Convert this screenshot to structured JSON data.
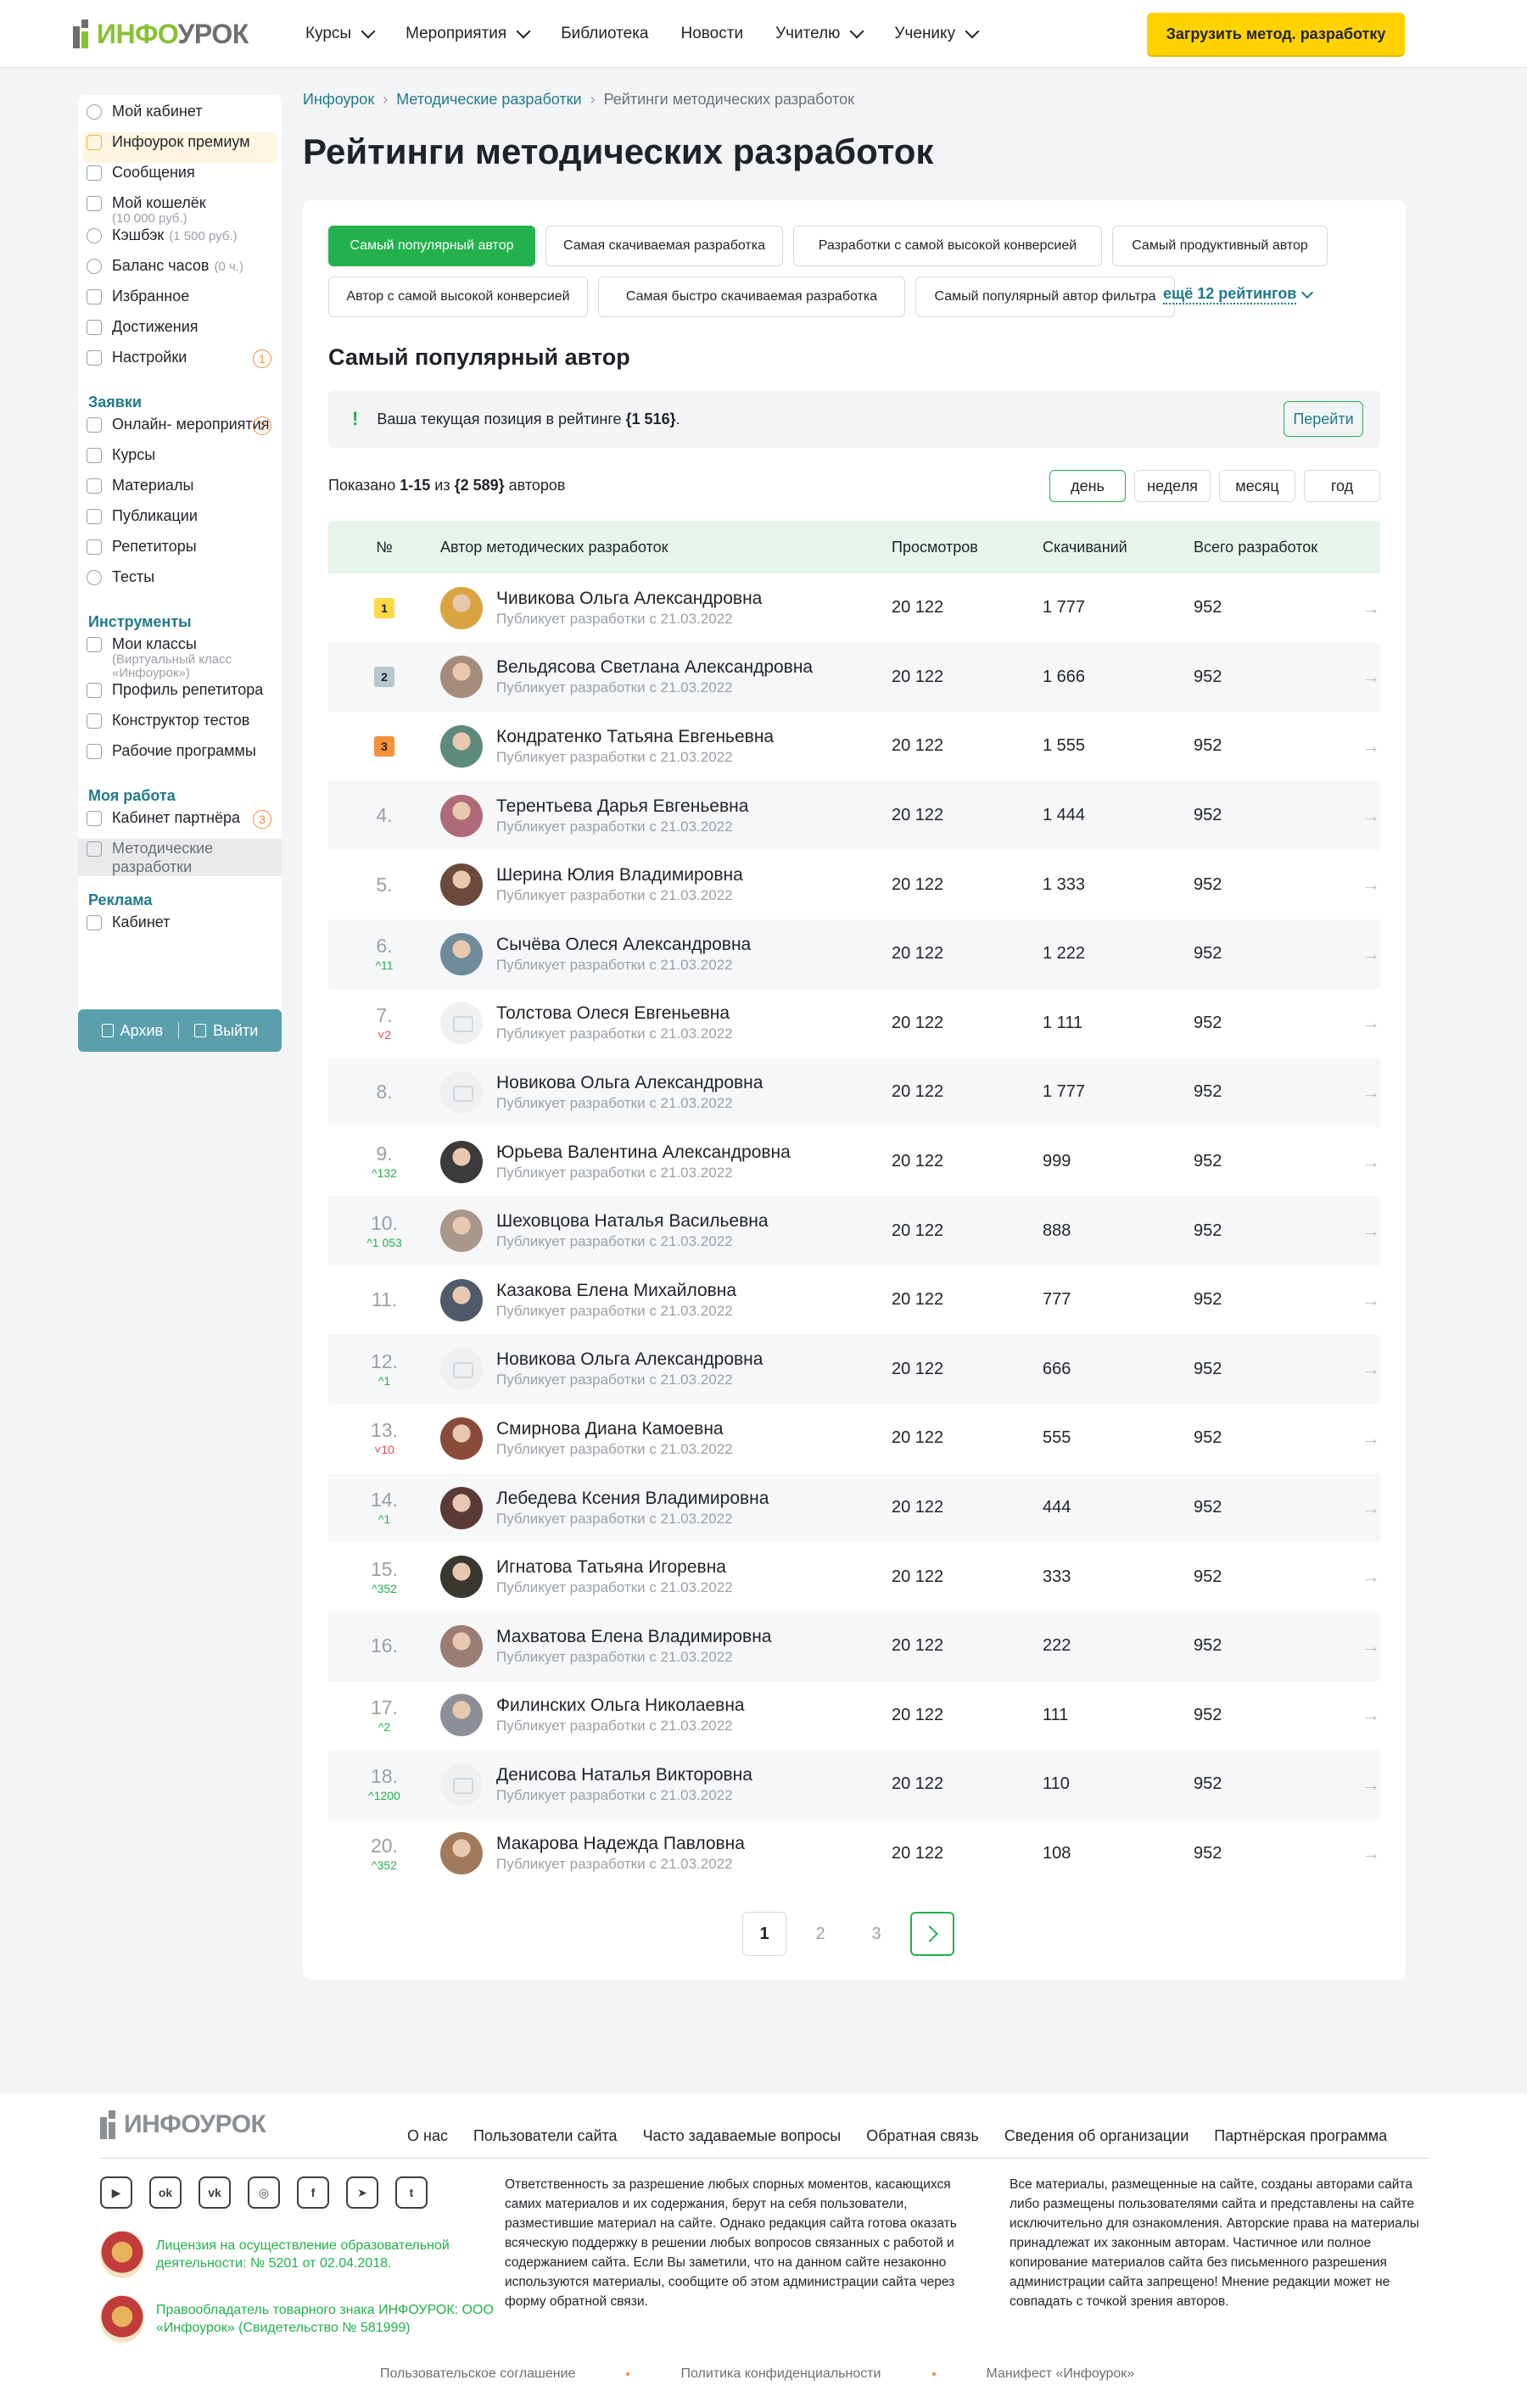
{
  "header": {
    "logo_text_a": "ИНФО",
    "logo_text_b": "УРОК",
    "nav": [
      {
        "label": "Курсы",
        "dropdown": true
      },
      {
        "label": "Мероприятия",
        "dropdown": true
      },
      {
        "label": "Библиотека",
        "dropdown": false
      },
      {
        "label": "Новости",
        "dropdown": false
      },
      {
        "label": "Учителю",
        "dropdown": true
      },
      {
        "label": "Ученику",
        "dropdown": true
      }
    ],
    "upload_label": "Загрузить метод. разработку"
  },
  "sidebar": {
    "items_top": [
      {
        "label": "Мой кабинет",
        "icon": "user-icon"
      },
      {
        "label": "Инфоурок премиум",
        "icon": "crown-icon"
      },
      {
        "label": "Сообщения",
        "icon": "mail-icon"
      },
      {
        "label": "Мой кошелёк",
        "sub2": "(10 000 руб.)",
        "icon": "wallet-icon"
      },
      {
        "label": "Кэшбэк",
        "sub": "(1 500 руб.)",
        "icon": "cashback-icon"
      },
      {
        "label": "Баланс часов",
        "sub": "(0 ч.)",
        "icon": "clock-icon"
      },
      {
        "label": "Избранное",
        "icon": "bookmark-icon"
      },
      {
        "label": "Достижения",
        "icon": "trophy-icon"
      },
      {
        "label": "Настройки",
        "icon": "gear-icon",
        "badge": "1"
      }
    ],
    "section_requests": "Заявки",
    "items_requests": [
      {
        "label": "Онлайн-\nмероприятия",
        "icon": "video-icon",
        "badge": "2"
      },
      {
        "label": "Курсы",
        "icon": "book-icon"
      },
      {
        "label": "Материалы",
        "icon": "star-icon"
      },
      {
        "label": "Публикации",
        "icon": "doc-icon"
      },
      {
        "label": "Репетиторы",
        "icon": "megaphone-icon"
      },
      {
        "label": "Тесты",
        "icon": "check-icon"
      }
    ],
    "section_tools": "Инструменты",
    "items_tools": [
      {
        "label": "Мои классы",
        "sub2": "(Виртуальный класс «Инфоурок»)",
        "icon": "group-icon"
      },
      {
        "label": "Профиль репетитора",
        "icon": "profile-icon"
      },
      {
        "label": "Конструктор тестов",
        "icon": "constructor-icon"
      },
      {
        "label": "Рабочие программы",
        "icon": "calendar-icon"
      }
    ],
    "section_work": "Моя работа",
    "items_work": [
      {
        "label": "Кабинет партнёра",
        "icon": "partner-icon",
        "badge": "3"
      },
      {
        "label": "Методические разработки",
        "icon": "doc-icon",
        "active": true
      }
    ],
    "section_ads": "Реклама",
    "items_ads": [
      {
        "label": "Кабинет",
        "icon": "grid-icon"
      }
    ],
    "archive_label": "Архив",
    "logout_label": "Выйти"
  },
  "breadcrumb": [
    "Инфоурок",
    "Методические разработки",
    "Рейтинги методических разработок"
  ],
  "page_title": "Рейтинги методических разработок",
  "tabs": [
    {
      "label": "Самый популярный автор",
      "active": true
    },
    {
      "label": "Самая скачиваемая разработка"
    },
    {
      "label": "Разработки с самой высокой конверсией"
    },
    {
      "label": "Самый продуктивный автор"
    },
    {
      "label": "Автор с самой высокой конверсией"
    },
    {
      "label": "Самая быстро скачиваемая разработка"
    },
    {
      "label": "Самый популярный автор фильтра"
    }
  ],
  "more_tabs_label": "ещё 12 рейтингов",
  "section_title": "Самый популярный автор",
  "notice": {
    "text_before": "Ваша текущая позиция в рейтинге ",
    "position": "{1 516}",
    "text_after": ".",
    "go_label": "Перейти"
  },
  "shown": {
    "prefix": "Показано ",
    "range": "1-15",
    "middle": " из ",
    "total": "{2 589}",
    "suffix": " авторов"
  },
  "periods": [
    {
      "label": "день",
      "active": true
    },
    {
      "label": "неделя"
    },
    {
      "label": "месяц"
    },
    {
      "label": "год"
    }
  ],
  "table": {
    "headers": [
      "№",
      "Автор методических разработок",
      "Просмотров",
      "Скачиваний",
      "Всего разработок"
    ],
    "rows": [
      {
        "rank": "1",
        "medal": "gold",
        "delta": "",
        "dir": "",
        "name": "Чивикова Ольга Александровна",
        "sub": "Публикует разработки с 21.03.2022",
        "views": "20 122",
        "downloads": "1 777",
        "total": "952",
        "avatar": "#d9a441"
      },
      {
        "rank": "2",
        "medal": "silver",
        "delta": "",
        "dir": "",
        "name": "Вельдясова Светлана Александровна",
        "sub": "Публикует разработки с 21.03.2022",
        "views": "20 122",
        "downloads": "1 666",
        "total": "952",
        "avatar": "#a58c7a"
      },
      {
        "rank": "3",
        "medal": "bronze",
        "delta": "",
        "dir": "",
        "name": "Кондратенко Татьяна Евгеньевна",
        "sub": "Публикует разработки с 21.03.2022",
        "views": "20 122",
        "downloads": "1 555",
        "total": "952",
        "avatar": "#5c8a7d"
      },
      {
        "rank": "4.",
        "medal": "",
        "delta": "",
        "dir": "",
        "name": "Терентьева Дарья Евгеньевна",
        "sub": "Публикует разработки с 21.03.2022",
        "views": "20 122",
        "downloads": "1 444",
        "total": "952",
        "avatar": "#b06b7a"
      },
      {
        "rank": "5.",
        "medal": "",
        "delta": "",
        "dir": "",
        "name": "Шерина Юлия Владимировна",
        "sub": "Публикует разработки с 21.03.2022",
        "views": "20 122",
        "downloads": "1 333",
        "total": "952",
        "avatar": "#6b4a3c"
      },
      {
        "rank": "6.",
        "medal": "",
        "delta": "11",
        "dir": "up",
        "name": "Сычёва Олеся Александровна",
        "sub": "Публикует разработки с 21.03.2022",
        "views": "20 122",
        "downloads": "1 222",
        "total": "952",
        "avatar": "#6f8a9a"
      },
      {
        "rank": "7.",
        "medal": "",
        "delta": "2",
        "dir": "down",
        "name": "Толстова Олеся Евгеньевна",
        "sub": "Публикует разработки с 21.03.2022",
        "views": "20 122",
        "downloads": "1 111",
        "total": "952",
        "avatar": ""
      },
      {
        "rank": "8.",
        "medal": "",
        "delta": "",
        "dir": "",
        "name": "Новикова Ольга Александровна",
        "sub": "Публикует разработки с 21.03.2022",
        "views": "20 122",
        "downloads": "1 777",
        "total": "952",
        "avatar": ""
      },
      {
        "rank": "9.",
        "medal": "",
        "delta": "132",
        "dir": "up",
        "name": "Юрьева Валентина Александровна",
        "sub": "Публикует разработки с 21.03.2022",
        "views": "20 122",
        "downloads": "999",
        "total": "952",
        "avatar": "#3c3a3a"
      },
      {
        "rank": "10.",
        "medal": "",
        "delta": "1 053",
        "dir": "up",
        "name": "Шеховцова Наталья Васильевна",
        "sub": "Публикует разработки с 21.03.2022",
        "views": "20 122",
        "downloads": "888",
        "total": "952",
        "avatar": "#a8978a"
      },
      {
        "rank": "11.",
        "medal": "",
        "delta": "",
        "dir": "",
        "name": "Казакова Елена Михайловна",
        "sub": "Публикует разработки с 21.03.2022",
        "views": "20 122",
        "downloads": "777",
        "total": "952",
        "avatar": "#4f5a6b"
      },
      {
        "rank": "12.",
        "medal": "",
        "delta": "1",
        "dir": "up",
        "name": "Новикова Ольга Александровна",
        "sub": "Публикует разработки с 21.03.2022",
        "views": "20 122",
        "downloads": "666",
        "total": "952",
        "avatar": ""
      },
      {
        "rank": "13.",
        "medal": "",
        "delta": "10",
        "dir": "down",
        "name": "Смирнова Диана Камоевна",
        "sub": "Публикует разработки с 21.03.2022",
        "views": "20 122",
        "downloads": "555",
        "total": "952",
        "avatar": "#8a4b3a"
      },
      {
        "rank": "14.",
        "medal": "",
        "delta": "1",
        "dir": "up",
        "name": "Лебедева Ксения Владимировна",
        "sub": "Публикует разработки с 21.03.2022",
        "views": "20 122",
        "downloads": "444",
        "total": "952",
        "avatar": "#5a3a34"
      },
      {
        "rank": "15.",
        "medal": "",
        "delta": "352",
        "dir": "up",
        "name": "Игнатова Татьяна Игоревна",
        "sub": "Публикует разработки с 21.03.2022",
        "views": "20 122",
        "downloads": "333",
        "total": "952",
        "avatar": "#3a3630"
      },
      {
        "rank": "16.",
        "medal": "",
        "delta": "",
        "dir": "",
        "name": "Махватова Елена Владимировна",
        "sub": "Публикует разработки с 21.03.2022",
        "views": "20 122",
        "downloads": "222",
        "total": "952",
        "avatar": "#9a7d74"
      },
      {
        "rank": "17.",
        "medal": "",
        "delta": "2",
        "dir": "up",
        "name": "Филинских Ольга Николаевна",
        "sub": "Публикует разработки с 21.03.2022",
        "views": "20 122",
        "downloads": "111",
        "total": "952",
        "avatar": "#8d8f98"
      },
      {
        "rank": "18.",
        "medal": "",
        "delta": "1200",
        "dir": "up",
        "name": "Денисова Наталья Викторовна",
        "sub": "Публикует разработки с 21.03.2022",
        "views": "20 122",
        "downloads": "110",
        "total": "952",
        "avatar": ""
      },
      {
        "rank": "20.",
        "medal": "",
        "delta": "352",
        "dir": "up",
        "name": "Макарова Надежда Павловна",
        "sub": "Публикует разработки с 21.03.2022",
        "views": "20 122",
        "downloads": "108",
        "total": "952",
        "avatar": "#a07a5a"
      }
    ]
  },
  "pagination": {
    "pages": [
      "1",
      "2",
      "3"
    ],
    "current": "1"
  },
  "footer": {
    "logo_text": "ИНФОУРОК",
    "nav": [
      "О нас",
      "Пользователи сайта",
      "Часто задаваемые вопросы",
      "Обратная связь",
      "Сведения об организации",
      "Партнёрская программа"
    ],
    "socials": [
      {
        "icon": "youtube-icon",
        "glyph": "▶"
      },
      {
        "icon": "odnoklassniki-icon",
        "glyph": "ok"
      },
      {
        "icon": "vk-icon",
        "glyph": "vk"
      },
      {
        "icon": "instagram-icon",
        "glyph": "◎"
      },
      {
        "icon": "facebook-icon",
        "glyph": "f"
      },
      {
        "icon": "telegram-icon",
        "glyph": "➤"
      },
      {
        "icon": "twitter-icon",
        "glyph": "t"
      }
    ],
    "license": "Лицензия на осуществление образовательной деятельности: № 5201 от 02.04.2018.",
    "trademark": "Правообладатель товарного знака ИНФОУРОК: ООО «Инфоурок» (Свидетельство № 581999)",
    "text_middle": "Ответственность за разрешение любых спорных моментов, касающихся самих материалов и их содержания, берут на себя пользователи, разместившие материал на сайте. Однако редакция сайта готова оказать всяческую поддержку в решении любых вопросов связанных с работой и содержанием сайта. Если Вы заметили, что на данном сайте незаконно используются материалы, сообщите об этом администрации сайта через форму обратной связи.",
    "text_right": "Все материалы, размещенные на сайте, созданы авторами сайта либо размещены пользователями сайта и представлены на сайте исключительно для ознакомления. Авторские права на материалы принадлежат их законным авторам. Частичное или полное копирование материалов сайта без письменного разрешения администрации сайта запрещено! Мнение редакции может не совпадать с точкой зрения авторов.",
    "bottom": [
      "Пользовательское соглашение",
      "Политика конфиденциальности",
      "Манифест «Инфоурок»"
    ]
  }
}
